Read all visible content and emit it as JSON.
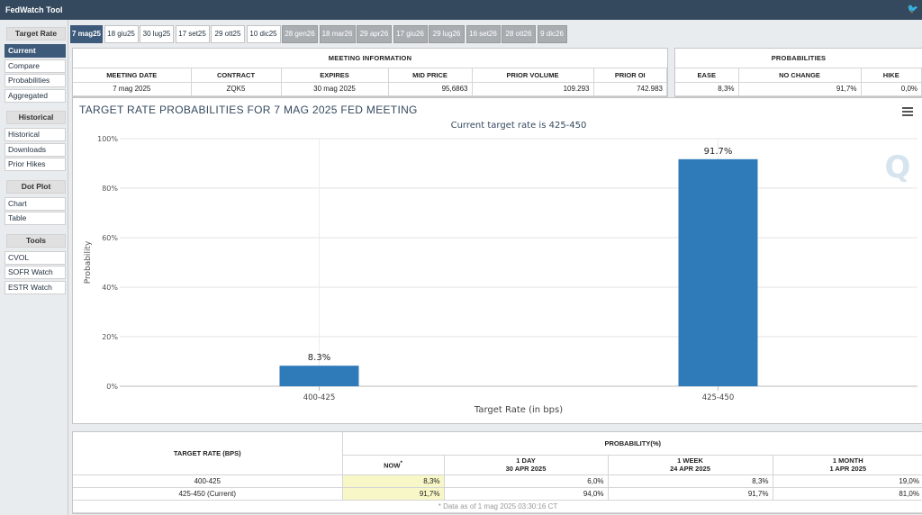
{
  "app_title": "FedWatch Tool",
  "sidebar": {
    "sections": [
      {
        "title": "Target Rate",
        "items": [
          "Current",
          "Compare",
          "Probabilities",
          "Aggregated"
        ],
        "active": 0
      },
      {
        "title": "Historical",
        "items": [
          "Historical",
          "Downloads",
          "Prior Hikes"
        ]
      },
      {
        "title": "Dot Plot",
        "items": [
          "Chart",
          "Table"
        ]
      },
      {
        "title": "Tools",
        "items": [
          "CVOL",
          "SOFR Watch",
          "ESTR Watch"
        ]
      }
    ]
  },
  "meeting_tabs": [
    "7 mag25",
    "18 giu25",
    "30 lug25",
    "17 set25",
    "29 ott25",
    "10 dic25",
    "28 gen26",
    "18 mar26",
    "29 apr26",
    "17 giu26",
    "29 lug26",
    "16 set26",
    "28 ott26",
    "9 dic26"
  ],
  "selected_tab": 0,
  "meeting_info": {
    "title": "MEETING INFORMATION",
    "headers": [
      "MEETING DATE",
      "CONTRACT",
      "EXPIRES",
      "MID PRICE",
      "PRIOR VOLUME",
      "PRIOR OI"
    ],
    "values": [
      "7 mag 2025",
      "ZQK5",
      "30 mag 2025",
      "95,6863",
      "109.293",
      "742.983"
    ]
  },
  "probabilities": {
    "title": "PROBABILITIES",
    "headers": [
      "EASE",
      "NO CHANGE",
      "HIKE"
    ],
    "values": [
      "8,3%",
      "91,7%",
      "0,0%"
    ]
  },
  "chart_panel": {
    "title": "TARGET RATE PROBABILITIES FOR 7 MAG 2025 FED MEETING"
  },
  "chart_data": {
    "type": "bar",
    "title": "TARGET RATE PROBABILITIES FOR 7 MAG 2025 FED MEETING",
    "subtitle": "Current target rate is 425-450",
    "categories": [
      "400-425",
      "425-450"
    ],
    "values": [
      8.3,
      91.7
    ],
    "data_labels": [
      "8.3%",
      "91.7%"
    ],
    "xlabel": "Target Rate (in bps)",
    "ylabel": "Probability",
    "ylim": [
      0,
      100
    ],
    "yticks": [
      "0%",
      "20%",
      "40%",
      "60%",
      "80%",
      "100%"
    ],
    "grid": true,
    "bar_color": "#2f7ab9"
  },
  "bottom_table": {
    "target_header": "TARGET RATE (BPS)",
    "probability_header": "PROBABILITY(%)",
    "columns": [
      {
        "label": "NOW",
        "marker": "*",
        "date": ""
      },
      {
        "label": "1 DAY",
        "date": "30 APR 2025"
      },
      {
        "label": "1 WEEK",
        "date": "24 APR 2025"
      },
      {
        "label": "1 MONTH",
        "date": "1 APR 2025"
      }
    ],
    "rows": [
      {
        "rate": "400-425",
        "values": [
          "8,3%",
          "6,0%",
          "8,3%",
          "19,0%"
        ]
      },
      {
        "rate": "425-450 (Current)",
        "values": [
          "91,7%",
          "94,0%",
          "91,7%",
          "81,0%"
        ]
      }
    ],
    "note": "* Data as of 1 mag 2025 03:30:16 CT"
  },
  "colors": {
    "titlebar": "#34495e",
    "active": "#3d5a7a",
    "highlight": "#f7f7c8"
  },
  "icons": {
    "menu": "hamburger-menu-icon",
    "watermark": "q-logo-watermark"
  }
}
